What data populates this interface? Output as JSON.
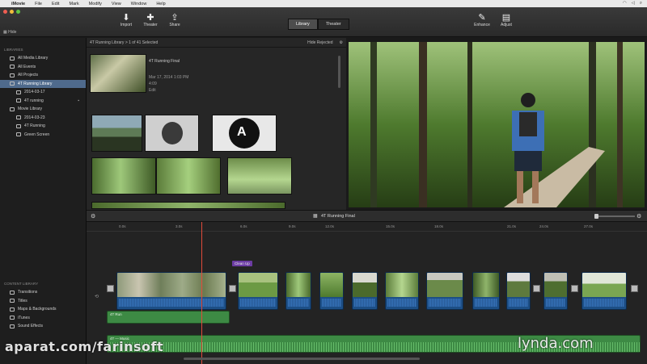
{
  "menubar": {
    "app": "iMovie",
    "items": [
      "File",
      "Edit",
      "Mark",
      "Modify",
      "View",
      "Window",
      "Help"
    ]
  },
  "toolbar": {
    "hide_label": "Hide",
    "import_label": "Import",
    "theater_label": "Theater",
    "share_label": "Share",
    "enhance_label": "Enhance",
    "adjust_label": "Adjust",
    "tabs": [
      {
        "label": "Library",
        "active": true
      },
      {
        "label": "Theater",
        "active": false
      }
    ]
  },
  "sidebar": {
    "libraries_header": "LIBRARIES",
    "items": [
      {
        "label": "All Media Library",
        "level": 1,
        "selected": false,
        "badge": ""
      },
      {
        "label": "All Events",
        "level": 1,
        "selected": false,
        "badge": ""
      },
      {
        "label": "All Projects",
        "level": 1,
        "selected": false,
        "badge": ""
      },
      {
        "label": "4T Running Library",
        "level": 1,
        "selected": true,
        "badge": ""
      },
      {
        "label": "2014-03-17",
        "level": 2,
        "selected": false,
        "badge": ""
      },
      {
        "label": "4T running",
        "level": 2,
        "selected": false,
        "badge": "▪"
      },
      {
        "label": "Movie Library",
        "level": 1,
        "selected": false,
        "badge": ""
      },
      {
        "label": "2014-03-23",
        "level": 2,
        "selected": false,
        "badge": ""
      },
      {
        "label": "4T Running",
        "level": 2,
        "selected": false,
        "badge": ""
      },
      {
        "label": "Green Screen",
        "level": 2,
        "selected": false,
        "badge": ""
      }
    ],
    "content_header": "CONTENT LIBRARY",
    "content_items": [
      {
        "label": "Transitions"
      },
      {
        "label": "Titles"
      },
      {
        "label": "Maps & Backgrounds"
      },
      {
        "label": "iTunes"
      },
      {
        "label": "Sound Effects"
      }
    ]
  },
  "browser": {
    "header_title": "4T Running Library > 1 of 41 Selected",
    "filter_label": "Hide Rejected",
    "project_title": "4T Running Final",
    "project_date": "Mar 17, 2014 1:03 PM",
    "project_duration": "4:09",
    "project_sub": "Edit"
  },
  "timeline": {
    "title": "4T Running Final",
    "ticks": [
      "0.0s",
      "3.0s",
      "6.0s",
      "9.0s",
      "12.0s",
      "15.0s",
      "18.0s",
      "21.0s",
      "24.0s",
      "27.0s"
    ],
    "title_clip_label": "Clean Up",
    "bg_music_label": "4T Run",
    "music_label": "4T — Music"
  },
  "watermarks": {
    "left": "aparat.com/farinsoft",
    "right": "lynda.com"
  },
  "colors": {
    "selection": "#4f6a8c",
    "video_clip": "#1d4f86",
    "audio_clip": "#3d8a44",
    "playhead": "#e04a3a",
    "title_clip": "#6c3ca3"
  }
}
